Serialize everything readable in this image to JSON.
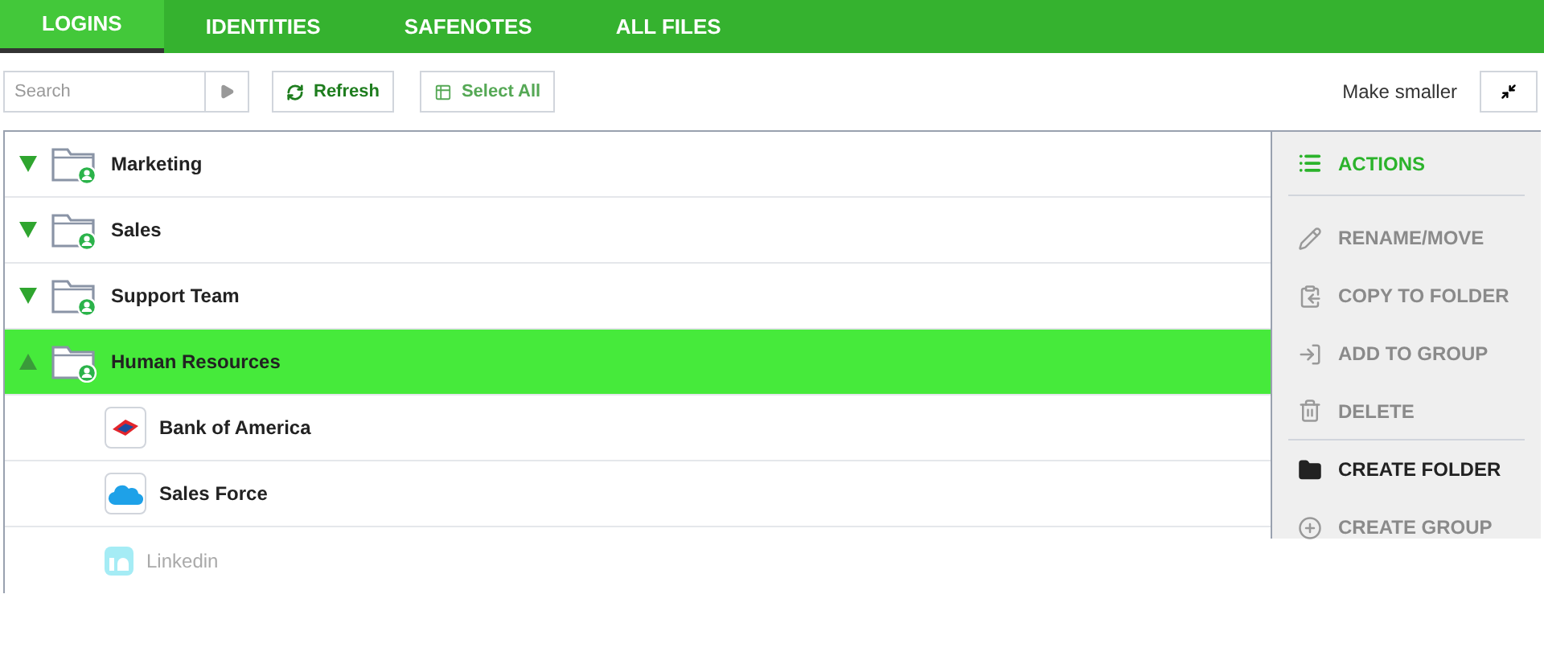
{
  "tabs": [
    {
      "label": "LOGINS",
      "selected": true
    },
    {
      "label": "IDENTITIES",
      "selected": false
    },
    {
      "label": "SAFENOTES",
      "selected": false
    },
    {
      "label": "ALL FILES",
      "selected": false
    }
  ],
  "search": {
    "placeholder": "Search"
  },
  "toolbar": {
    "refresh": "Refresh",
    "select_all": "Select All",
    "make_smaller": "Make smaller"
  },
  "folders": [
    {
      "name": "Marketing",
      "expanded": false,
      "selected": false
    },
    {
      "name": "Sales",
      "expanded": false,
      "selected": false
    },
    {
      "name": "Support Team",
      "expanded": false,
      "selected": false
    },
    {
      "name": "Human Resources",
      "expanded": true,
      "selected": true,
      "children": [
        {
          "name": "Bank of America",
          "kind": "bank",
          "dimmed": false
        },
        {
          "name": "Sales Force",
          "kind": "cloud",
          "dimmed": false
        },
        {
          "name": "Linkedin",
          "kind": "social",
          "dimmed": true
        }
      ]
    }
  ],
  "actions": {
    "title": "ACTIONS",
    "items": [
      {
        "label": "RENAME/MOVE",
        "kind": "pencil",
        "disabled": true
      },
      {
        "label": "COPY TO FOLDER",
        "kind": "copy",
        "disabled": true
      },
      {
        "label": "ADD TO GROUP",
        "kind": "enter",
        "disabled": true
      },
      {
        "label": "DELETE",
        "kind": "trash",
        "disabled": true
      },
      {
        "label": "CREATE FOLDER",
        "kind": "folder",
        "disabled": false
      },
      {
        "label": "CREATE GROUP",
        "kind": "plus",
        "disabled": true
      }
    ]
  }
}
